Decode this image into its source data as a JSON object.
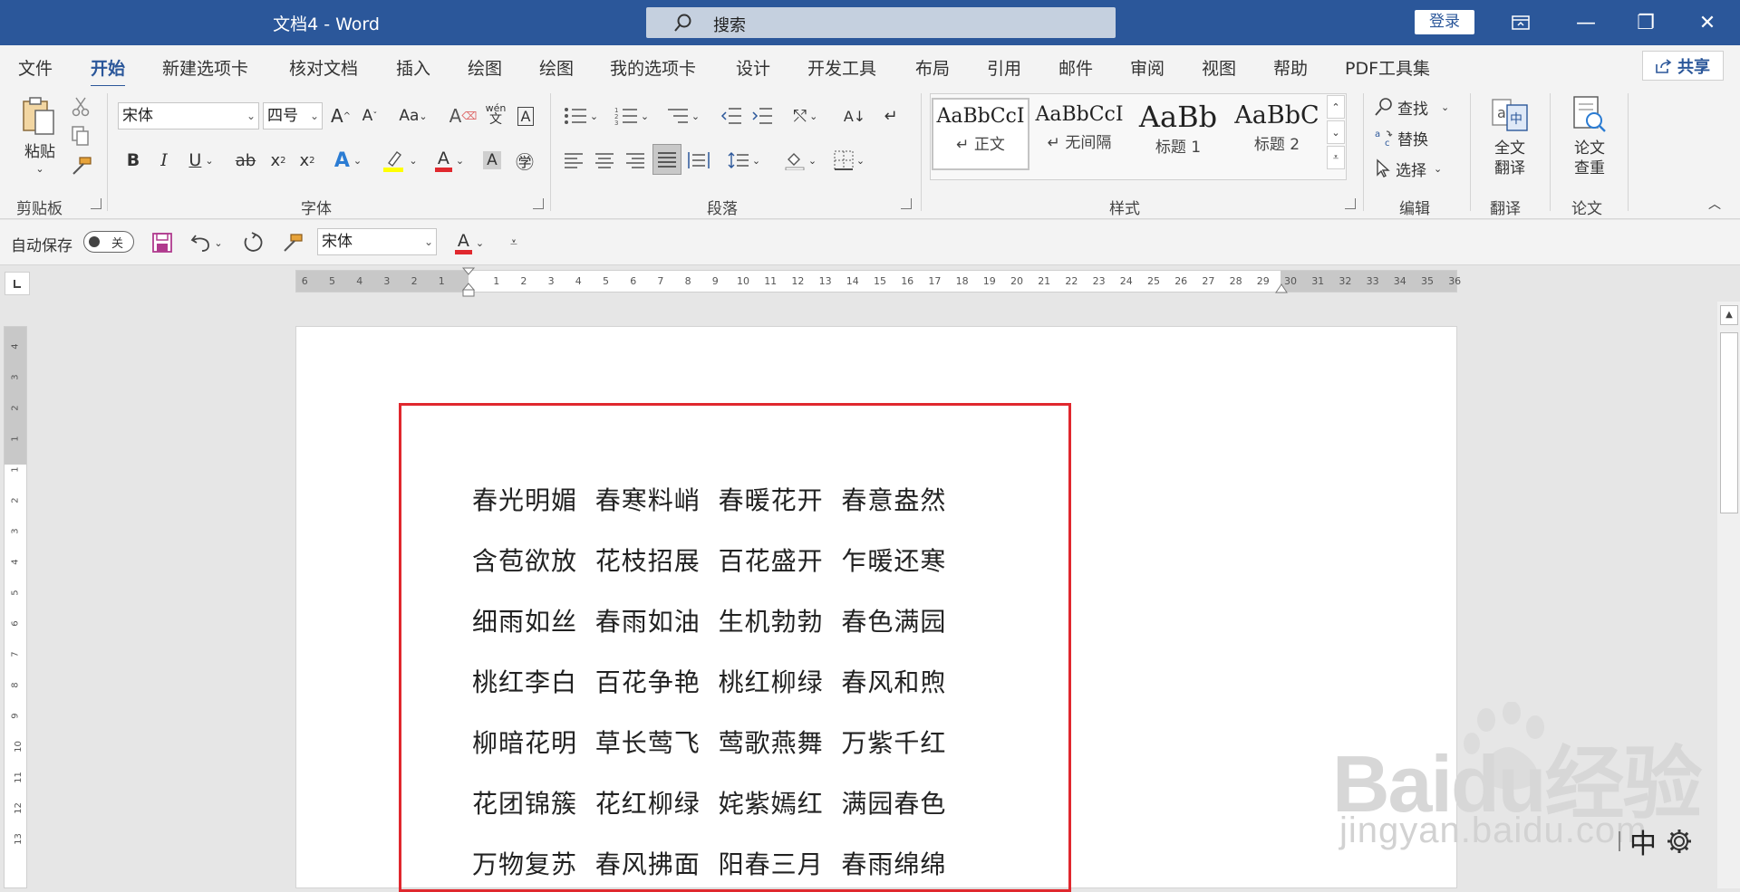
{
  "titlebar": {
    "doc_title": "文档4  -  Word",
    "search_placeholder": "搜索",
    "login_label": "登录",
    "minimize": "—",
    "maximize": "❐",
    "close": "✕"
  },
  "menu": {
    "tabs": [
      "文件",
      "开始",
      "新建选项卡",
      "核对文档",
      "插入",
      "绘图",
      "绘图",
      "我的选项卡",
      "设计",
      "开发工具",
      "布局",
      "引用",
      "邮件",
      "审阅",
      "视图",
      "帮助",
      "PDF工具集"
    ],
    "active_tab": "开始",
    "share_label": "共享"
  },
  "ribbon": {
    "clipboard": {
      "paste_label": "粘贴",
      "group_label": "剪贴板"
    },
    "font": {
      "font_name": "宋体",
      "font_size": "四号",
      "group_label": "字体",
      "case_label": "Aa",
      "phonetic_top": "wén",
      "phonetic_bottom": "文"
    },
    "paragraph": {
      "group_label": "段落"
    },
    "styles": {
      "group_label": "样式",
      "items": [
        {
          "sample": "AaBbCcI",
          "name": "↵ 正文"
        },
        {
          "sample": "AaBbCcI",
          "name": "↵ 无间隔"
        },
        {
          "sample": "AaBb",
          "name": "标题 1"
        },
        {
          "sample": "AaBbC",
          "name": "标题 2"
        }
      ]
    },
    "editing": {
      "find_label": "查找",
      "replace_label": "替换",
      "select_label": "选择",
      "group_label": "编辑"
    },
    "translate": {
      "button_line1": "全文",
      "button_line2": "翻译",
      "group_label": "翻译"
    },
    "paper": {
      "button_line1": "论文",
      "button_line2": "查重",
      "group_label": "论文"
    }
  },
  "qat": {
    "autosave_label": "自动保存",
    "autosave_state": "关",
    "font_name": "宋体"
  },
  "ruler": {
    "left_numbers": [
      "6",
      "5",
      "4",
      "3",
      "2",
      "1"
    ],
    "right_numbers": [
      "1",
      "2",
      "3",
      "4",
      "5",
      "6",
      "7",
      "8",
      "9",
      "10",
      "11",
      "12",
      "13",
      "14",
      "15",
      "16",
      "17",
      "18",
      "19",
      "20",
      "21",
      "22",
      "23",
      "24",
      "25",
      "26",
      "27",
      "28",
      "29",
      "30",
      "31",
      "32",
      "33",
      "34",
      "35",
      "36"
    ],
    "vertical_numbers": [
      "4",
      "3",
      "2",
      "1",
      "1",
      "2",
      "3",
      "4",
      "5",
      "6",
      "7",
      "8",
      "9",
      "10",
      "11",
      "12",
      "13"
    ]
  },
  "document": {
    "lines": [
      "春光明媚  春寒料峭  春暖花开  春意盎然",
      "含苞欲放  花枝招展  百花盛开  乍暖还寒",
      "细雨如丝  春雨如油  生机勃勃  春色满园",
      "桃红李白  百花争艳  桃红柳绿  春风和煦",
      "柳暗花明  草长莺飞  莺歌燕舞  万紫千红",
      "花团锦簇  花红柳绿  姹紫嫣红  满园春色",
      "万物复苏  春风拂面  阳春三月  春雨绵绵"
    ]
  },
  "watermark": {
    "logo": "Baidu经验",
    "url": "jingyan.baidu.com"
  },
  "ime": {
    "mode": "中"
  },
  "colors": {
    "title_bar": "#2b579a",
    "accent": "#2b579a",
    "frame": "#e0282e",
    "font_color_bar": "#e0282e",
    "highlight": "#ffff00"
  }
}
